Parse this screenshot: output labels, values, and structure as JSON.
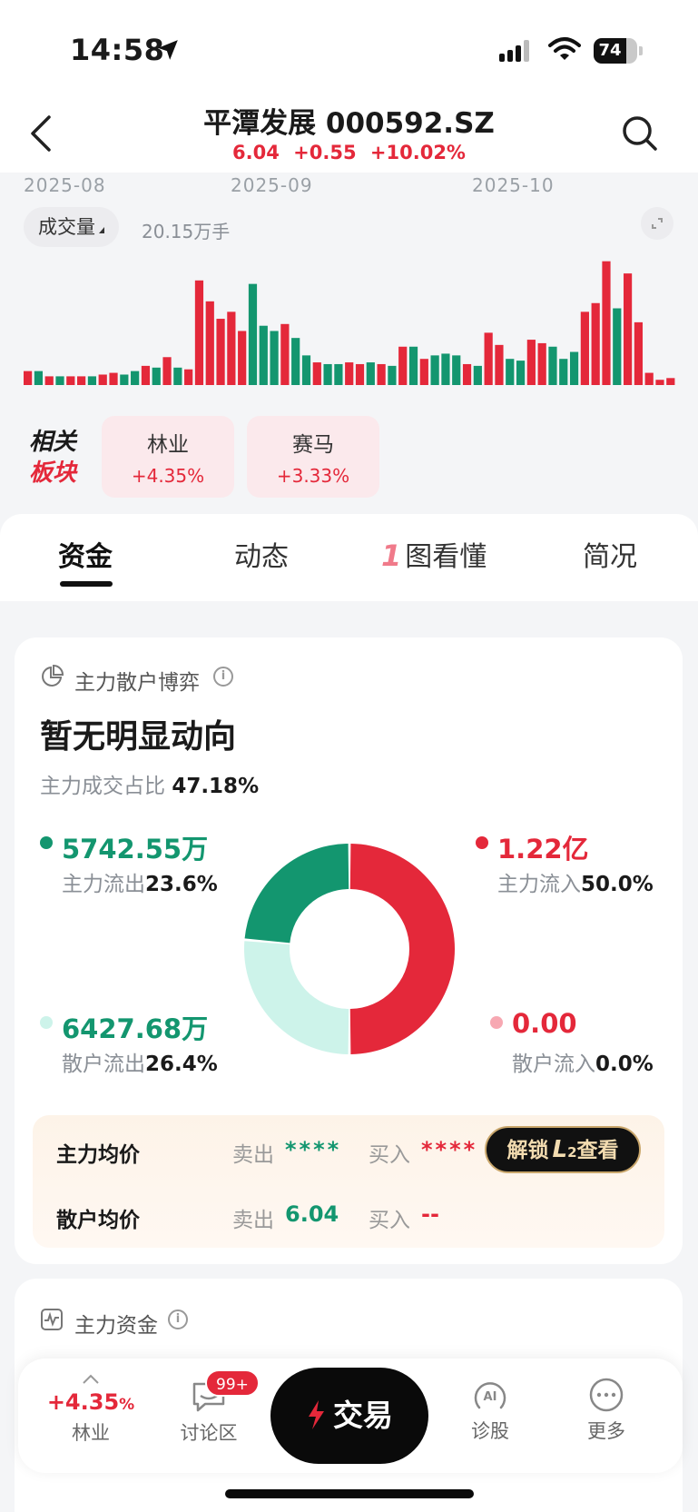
{
  "status_bar": {
    "time": "14:58",
    "battery": "74",
    "battery_level": 0.74
  },
  "header": {
    "title": "平潭发展 000592.SZ",
    "price": "6.04",
    "change": "+0.55",
    "change_pct": "+10.02%"
  },
  "dates": [
    "2025-08",
    "2025-09",
    "2025-10"
  ],
  "volume": {
    "label": "成交量",
    "value": "20.15万手",
    "bars": [
      {
        "v": 8,
        "c": "r"
      },
      {
        "v": 8,
        "c": "g"
      },
      {
        "v": 5,
        "c": "r"
      },
      {
        "v": 5,
        "c": "g"
      },
      {
        "v": 5,
        "c": "r"
      },
      {
        "v": 5,
        "c": "r"
      },
      {
        "v": 5,
        "c": "g"
      },
      {
        "v": 6,
        "c": "r"
      },
      {
        "v": 7,
        "c": "r"
      },
      {
        "v": 6,
        "c": "g"
      },
      {
        "v": 8,
        "c": "g"
      },
      {
        "v": 11,
        "c": "r"
      },
      {
        "v": 10,
        "c": "g"
      },
      {
        "v": 16,
        "c": "r"
      },
      {
        "v": 10,
        "c": "g"
      },
      {
        "v": 9,
        "c": "r"
      },
      {
        "v": 60,
        "c": "r"
      },
      {
        "v": 48,
        "c": "r"
      },
      {
        "v": 38,
        "c": "r"
      },
      {
        "v": 42,
        "c": "r"
      },
      {
        "v": 31,
        "c": "r"
      },
      {
        "v": 58,
        "c": "g"
      },
      {
        "v": 34,
        "c": "g"
      },
      {
        "v": 31,
        "c": "g"
      },
      {
        "v": 35,
        "c": "r"
      },
      {
        "v": 27,
        "c": "g"
      },
      {
        "v": 17,
        "c": "g"
      },
      {
        "v": 13,
        "c": "r"
      },
      {
        "v": 12,
        "c": "g"
      },
      {
        "v": 12,
        "c": "g"
      },
      {
        "v": 13,
        "c": "r"
      },
      {
        "v": 12,
        "c": "r"
      },
      {
        "v": 13,
        "c": "g"
      },
      {
        "v": 12,
        "c": "r"
      },
      {
        "v": 11,
        "c": "g"
      },
      {
        "v": 22,
        "c": "r"
      },
      {
        "v": 22,
        "c": "g"
      },
      {
        "v": 15,
        "c": "r"
      },
      {
        "v": 17,
        "c": "g"
      },
      {
        "v": 18,
        "c": "g"
      },
      {
        "v": 17,
        "c": "g"
      },
      {
        "v": 12,
        "c": "r"
      },
      {
        "v": 11,
        "c": "g"
      },
      {
        "v": 30,
        "c": "r"
      },
      {
        "v": 23,
        "c": "r"
      },
      {
        "v": 15,
        "c": "g"
      },
      {
        "v": 14,
        "c": "g"
      },
      {
        "v": 26,
        "c": "r"
      },
      {
        "v": 24,
        "c": "r"
      },
      {
        "v": 22,
        "c": "g"
      },
      {
        "v": 15,
        "c": "g"
      },
      {
        "v": 19,
        "c": "g"
      },
      {
        "v": 42,
        "c": "r"
      },
      {
        "v": 47,
        "c": "r"
      },
      {
        "v": 71,
        "c": "r"
      },
      {
        "v": 44,
        "c": "g"
      },
      {
        "v": 64,
        "c": "r"
      },
      {
        "v": 36,
        "c": "r"
      },
      {
        "v": 7,
        "c": "r"
      },
      {
        "v": 3,
        "c": "r"
      },
      {
        "v": 4,
        "c": "r"
      }
    ]
  },
  "related": {
    "label_line1": "相关",
    "label_line2": "板块",
    "items": [
      {
        "name": "林业",
        "pct": "+4.35%"
      },
      {
        "name": "赛马",
        "pct": "+3.33%"
      }
    ]
  },
  "tabs": [
    "资金",
    "动态",
    "图看懂",
    "简况"
  ],
  "tab_one_glyph": "1",
  "flow": {
    "title": "主力散户博弈",
    "headline": "暂无明显动向",
    "ratio_label": "主力成交占比",
    "ratio_value": "47.18%",
    "main_out": {
      "amount": "5742.55万",
      "label": "主力流出",
      "pct": "23.6%",
      "fraction": 0.236
    },
    "main_in": {
      "amount": "1.22亿",
      "label": "主力流入",
      "pct": "50.0%",
      "fraction": 0.5
    },
    "retail_out": {
      "amount": "6427.68万",
      "label": "散户流出",
      "pct": "26.4%",
      "fraction": 0.264
    },
    "retail_in": {
      "amount": "0.00",
      "label": "散户流入",
      "pct": "0.0%",
      "fraction": 0.0
    },
    "colors": {
      "main_in": "#e4283a",
      "main_out": "#13966f",
      "retail_out": "#cdf3ea",
      "retail_in": "#f7a8b2"
    }
  },
  "avg_price": {
    "main_label": "主力均价",
    "retail_label": "散户均价",
    "sell_key": "卖出",
    "buy_key": "买入",
    "main_sell": "****",
    "main_buy": "****",
    "retail_sell": "6.04",
    "retail_buy": "--",
    "unlock_label_a": "解锁",
    "unlock_label_b": "查看",
    "unlock_l": "L",
    "unlock_sub": "2"
  },
  "capital": {
    "title": "主力资金"
  },
  "bottom_nav": {
    "sector_pct": "+4.35",
    "sector_pct_unit": "%",
    "sector_name": "林业",
    "discuss": "讨论区",
    "discuss_badge": "99+",
    "trade": "交易",
    "diagnose": "诊股",
    "diagnose_ai": "AI",
    "more": "更多"
  }
}
